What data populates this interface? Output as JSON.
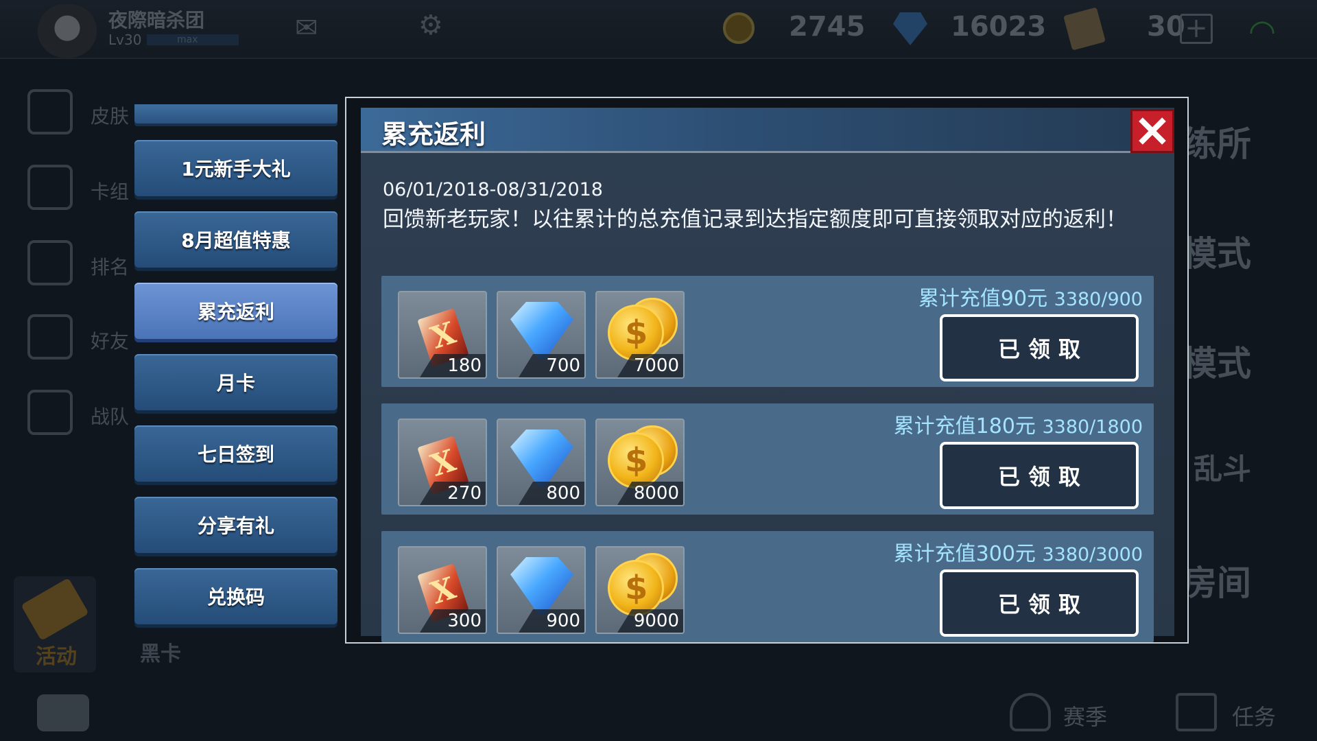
{
  "background": {
    "player_name": "夜際暗杀团",
    "player_level": "Lv30",
    "xp_text": "max",
    "coins": "2745",
    "gems": "16023",
    "tickets": "30",
    "left_nav": [
      "皮肤",
      "卡组",
      "排名",
      "好友",
      "战队"
    ],
    "activity_label": "活动",
    "blackcard_label": "黑卡",
    "right_modes": [
      "训练所",
      "单人模式",
      "团队模式",
      "乱斗",
      "自定义房间"
    ],
    "season_label": "赛季",
    "task_label": "任务"
  },
  "menu": {
    "items": [
      {
        "label": "1元新手大礼"
      },
      {
        "label": "8月超值特惠"
      },
      {
        "label": "累充返利"
      },
      {
        "label": "月卡"
      },
      {
        "label": "七日签到"
      },
      {
        "label": "分享有礼"
      },
      {
        "label": "兑换码"
      }
    ],
    "active_index": 2
  },
  "modal": {
    "title": "累充返利",
    "date_range": "06/01/2018-08/31/2018",
    "description": "回馈新老玩家！以往累计的总充值记录到达指定额度即可直接领取对应的返利！",
    "rows": [
      {
        "threshold": "累计充值90元",
        "progress": "3380/900",
        "claim_label": "已领取",
        "items": [
          {
            "icon": "ticket-icon",
            "qty": "180"
          },
          {
            "icon": "gem-icon",
            "qty": "700"
          },
          {
            "icon": "gold-coin-icon",
            "qty": "7000"
          }
        ]
      },
      {
        "threshold": "累计充值180元",
        "progress": "3380/1800",
        "claim_label": "已领取",
        "items": [
          {
            "icon": "ticket-icon",
            "qty": "270"
          },
          {
            "icon": "gem-icon",
            "qty": "800"
          },
          {
            "icon": "gold-coin-icon",
            "qty": "8000"
          }
        ]
      },
      {
        "threshold": "累计充值300元",
        "progress": "3380/3000",
        "claim_label": "已领取",
        "items": [
          {
            "icon": "ticket-icon",
            "qty": "300"
          },
          {
            "icon": "gem-icon",
            "qty": "900"
          },
          {
            "icon": "gold-coin-icon",
            "qty": "9000"
          }
        ]
      }
    ]
  },
  "colors": {
    "accent_blue": "#4a74b8",
    "close_red": "#c8202a",
    "threshold_text": "#a4e4ff",
    "row_bg": "#4a6a8a"
  }
}
